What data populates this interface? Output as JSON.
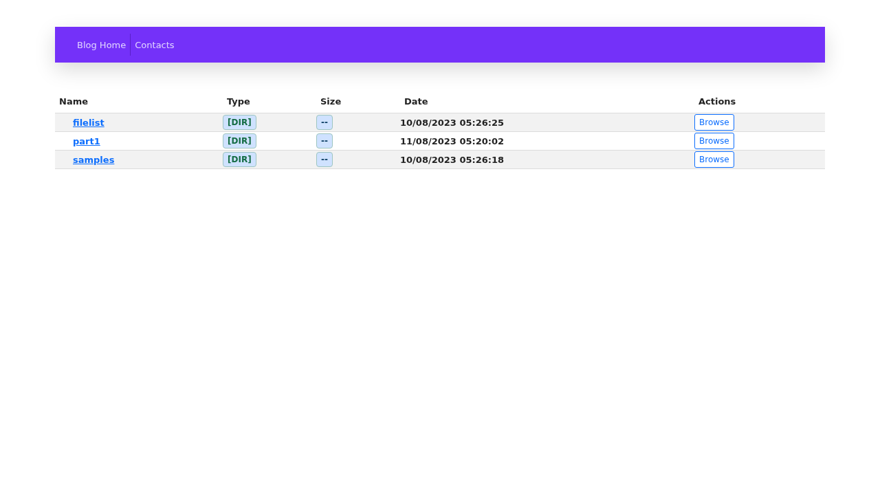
{
  "nav": {
    "links": [
      {
        "label": "Blog Home"
      },
      {
        "label": "Contacts"
      }
    ]
  },
  "table": {
    "columns": [
      "Name",
      "Type",
      "Size",
      "Date",
      "Actions"
    ],
    "rows": [
      {
        "name": "filelist",
        "type": "[DIR]",
        "size": "--",
        "date": "10/08/2023 05:26:25",
        "action": "Browse"
      },
      {
        "name": "part1",
        "type": "[DIR]",
        "size": "--",
        "date": "11/08/2023 05:20:02",
        "action": "Browse"
      },
      {
        "name": "samples",
        "type": "[DIR]",
        "size": "--",
        "date": "10/08/2023 05:26:18",
        "action": "Browse"
      }
    ]
  }
}
